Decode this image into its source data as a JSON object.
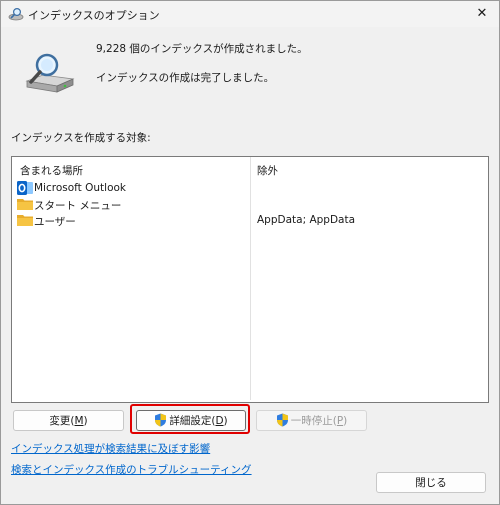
{
  "window": {
    "title": "インデックスのオプション",
    "close_glyph": "✕"
  },
  "status": {
    "count_text": "9,228 個のインデックスが作成されました。",
    "completion_text": "インデックスの作成は完了しました。"
  },
  "section_label": "インデックスを作成する対象:",
  "list": {
    "columns": {
      "location": "含まれる場所",
      "exclude": "除外"
    },
    "rows": [
      {
        "name": "Microsoft Outlook",
        "exclude": "",
        "icon": "outlook-icon"
      },
      {
        "name": "スタート メニュー",
        "exclude": "",
        "icon": "folder-icon"
      },
      {
        "name": "ユーザー",
        "exclude": "AppData; AppData",
        "icon": "folder-icon"
      }
    ]
  },
  "buttons": {
    "modify": {
      "label": "変更(",
      "key": "M",
      "suffix": ")"
    },
    "advanced": {
      "label": "詳細設定(",
      "key": "D",
      "suffix": ")"
    },
    "pause": {
      "label": "一時停止(",
      "key": "P",
      "suffix": ")"
    },
    "close": {
      "label": "閉じる"
    }
  },
  "links": {
    "effect": "インデックス処理が検索結果に及ぼす影響",
    "troubleshoot": "検索とインデックス作成のトラブルシューティング"
  },
  "colors": {
    "highlight": "#e00000",
    "link": "#0066cc",
    "folder": "#f6c443",
    "outlook": "#0a64c8"
  }
}
